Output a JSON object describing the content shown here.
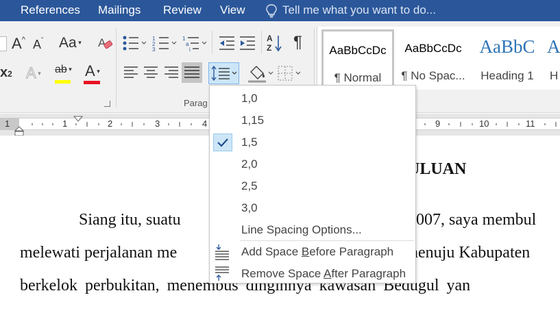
{
  "tabs": [
    "References",
    "Mailings",
    "Review",
    "View"
  ],
  "tell_me": "Tell me what you want to do...",
  "ribbon": {
    "font_buttons": {
      "grow": "A",
      "shrink": "A",
      "change_case": "Aa",
      "subscript_suffix": "x",
      "subscript_digit": "2",
      "text_effects": "A",
      "highlight": "ab",
      "font_color": "A"
    },
    "paragraph_label": "Parag",
    "sort_label": "A Z",
    "pilcrow": "¶",
    "highlight_color": "#ffff00",
    "font_color_value": "#e81123"
  },
  "styles": [
    {
      "sample": "AaBbCcDc",
      "name": "¶ Normal"
    },
    {
      "sample": "AaBbCcDc",
      "name": "¶ No Spac..."
    },
    {
      "sample": "AaBbC",
      "name": "Heading 1"
    },
    {
      "sample": "Aa",
      "name": "H"
    }
  ],
  "ruler": {
    "numbers": [
      "1",
      "1",
      "2",
      "3",
      "4",
      "9",
      "10",
      "11"
    ]
  },
  "document": {
    "heading_fragment": "ULUAN",
    "lines": [
      {
        "left": "Siang itu, suatu",
        "right": "007, saya membul"
      },
      {
        "left": "melewati perjalanan me",
        "right": "nenuju Kabupaten"
      },
      {
        "left": "berkelok perbukitan, menembus dinginnya kawasan Bedugul yan"
      }
    ]
  },
  "line_spacing_menu": {
    "options": [
      "1,0",
      "1,15",
      "1,5",
      "2,0",
      "2,5",
      "3,0"
    ],
    "selected": "1,5",
    "options_link": "Line Spacing Options...",
    "add_before_pre": "Add Space ",
    "add_before_key": "B",
    "add_before_post": "efore Paragraph",
    "remove_after_pre": "Remove Space ",
    "remove_after_key": "A",
    "remove_after_post": "fter Paragraph"
  },
  "colors": {
    "tab_bar": "#2b579a",
    "ribbon_bg": "#f1f1f1",
    "check_highlight": "#cde6f7",
    "heading_style": "#2e74b5"
  }
}
